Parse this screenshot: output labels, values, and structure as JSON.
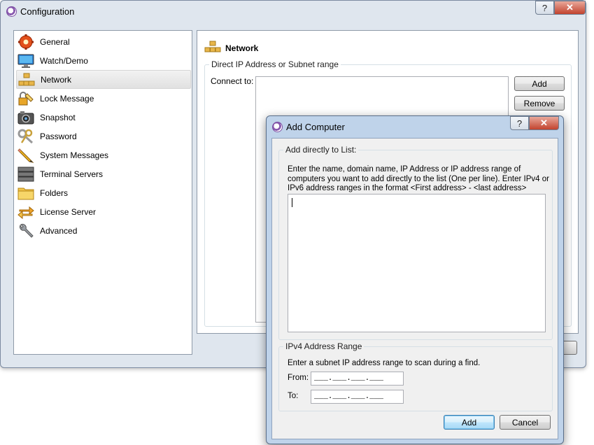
{
  "main_window": {
    "title": "Configuration",
    "help_glyph": "?",
    "close_glyph": "✕"
  },
  "sidebar": {
    "items": [
      {
        "label": "General",
        "icon": "gear-icon"
      },
      {
        "label": "Watch/Demo",
        "icon": "monitor-icon"
      },
      {
        "label": "Network",
        "icon": "network-icon",
        "selected": true
      },
      {
        "label": "Lock Message",
        "icon": "lock-message-icon"
      },
      {
        "label": "Snapshot",
        "icon": "camera-icon"
      },
      {
        "label": "Password",
        "icon": "keys-icon"
      },
      {
        "label": "System Messages",
        "icon": "pencil-icon"
      },
      {
        "label": "Terminal Servers",
        "icon": "server-icon"
      },
      {
        "label": "Folders",
        "icon": "folder-icon"
      },
      {
        "label": "License Server",
        "icon": "arrows-icon"
      },
      {
        "label": "Advanced",
        "icon": "wrench-icon"
      }
    ]
  },
  "network_page": {
    "heading": "Network",
    "group_title": "Direct IP Address or Subnet range",
    "connect_label": "Connect to:",
    "add_label": "Add",
    "remove_label": "Remove"
  },
  "dialog": {
    "title": "Add Computer",
    "help_glyph": "?",
    "close_glyph": "✕",
    "direct_group_title": "Add directly to List:",
    "direct_description": "Enter the name, domain name, IP Address or IP address range of computers you want to add directly to the list (One per line).  Enter IPv4 or IPv6 address ranges in the format <First address> - <last address>",
    "input_value": "",
    "range_group_title": "IPv4 Address Range",
    "range_description": "Enter a subnet IP address range to scan during a find.",
    "from_label": "From:",
    "to_label": "To:",
    "from_value": "___.___.___.___",
    "to_value": "___.___.___.___",
    "add_label": "Add",
    "cancel_label": "Cancel"
  },
  "colors": {
    "selection_bg": "#e6e6e6",
    "dialog_frame": "#bfd3ea",
    "close_button": "#c2432e",
    "default_button": "#3c7fb1"
  }
}
